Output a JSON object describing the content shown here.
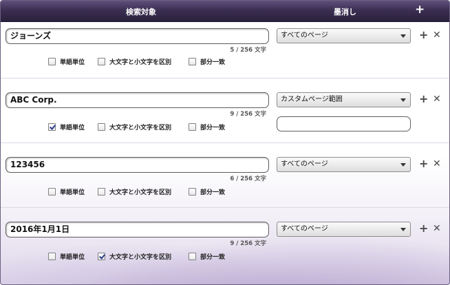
{
  "header": {
    "search_target_label": "検索対象",
    "redact_label": "墨消し",
    "add_symbol": "+"
  },
  "rows": [
    {
      "term": "ジョーンズ",
      "counter": "5 / 256 文字",
      "options": [
        {
          "label": "単語単位",
          "checked": false
        },
        {
          "label": "大文字と小文字を区別",
          "checked": false
        },
        {
          "label": "部分一致",
          "checked": false
        }
      ],
      "scope": "すべてのページ"
    },
    {
      "term": "ABC Corp.",
      "counter": "9 / 256 文字",
      "options": [
        {
          "label": "単語単位",
          "checked": true
        },
        {
          "label": "大文字と小文字を区別",
          "checked": false
        },
        {
          "label": "部分一致",
          "checked": false
        }
      ],
      "scope": "カスタムページ範囲",
      "page_range": ""
    },
    {
      "term": "123456",
      "counter": "6 / 256 文字",
      "options": [
        {
          "label": "単語単位",
          "checked": false
        },
        {
          "label": "大文字と小文字を区別",
          "checked": false
        },
        {
          "label": "部分一致",
          "checked": false
        }
      ],
      "scope": "すべてのページ"
    },
    {
      "term": "2016年1月1日",
      "counter": "9 / 256 文字",
      "options": [
        {
          "label": "単語単位",
          "checked": false
        },
        {
          "label": "大文字と小文字を区別",
          "checked": true
        },
        {
          "label": "部分一致",
          "checked": false
        }
      ],
      "scope": "すべてのページ"
    }
  ],
  "icons": {
    "add": "plus-icon",
    "remove": "close-icon",
    "dropdown": "chevron-down-icon"
  },
  "colors": {
    "header_top": "#5f4f7c",
    "header_bottom": "#2a213c",
    "background_accent": "#ded6ea"
  }
}
